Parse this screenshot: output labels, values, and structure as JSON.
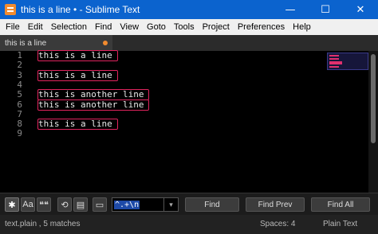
{
  "window": {
    "title": "this is a line • - Sublime Text",
    "controls": [
      "—",
      "☐",
      "✕"
    ]
  },
  "menu": [
    "File",
    "Edit",
    "Selection",
    "Find",
    "View",
    "Goto",
    "Tools",
    "Project",
    "Preferences",
    "Help"
  ],
  "tab": {
    "label": "this is a line",
    "dirty": true
  },
  "editor": {
    "line_numbers": [
      "1",
      "2",
      "3",
      "4",
      "5",
      "6",
      "7",
      "8",
      "9"
    ],
    "lines": [
      "this is a line",
      "",
      "this is a line",
      "",
      "this is another line",
      "this is another line",
      "",
      "this is a line",
      ""
    ],
    "match_lines": [
      1,
      3,
      5,
      6,
      8
    ],
    "match_color": "#e0245e"
  },
  "find": {
    "options": {
      "regex": "✱",
      "case": "Aa",
      "whole_word": "❝❝",
      "wrap": "⟲",
      "in_selection": "▤"
    },
    "query": "^.+\\n",
    "find_label": "Find",
    "find_prev_label": "Find Prev",
    "find_all_label": "Find All"
  },
  "status": {
    "left": "text.plain , 5 matches",
    "spaces": "Spaces: 4",
    "syntax": "Plain Text"
  },
  "colors": {
    "titlebar": "#0b63ce",
    "accent": "#f18b2f"
  }
}
